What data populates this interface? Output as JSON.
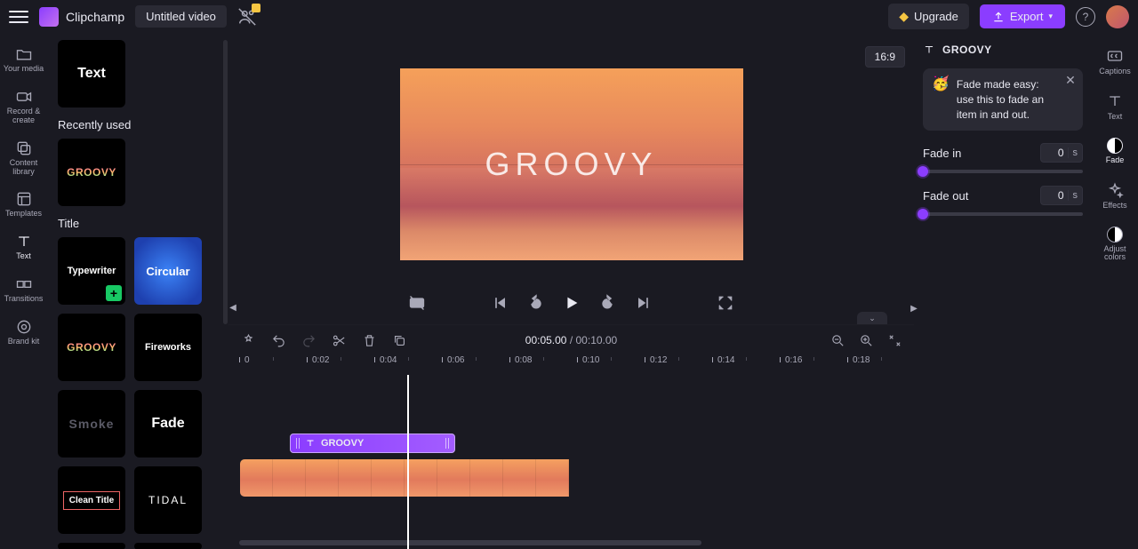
{
  "header": {
    "brand": "Clipchamp",
    "project_title": "Untitled video",
    "upgrade_label": "Upgrade",
    "export_label": "Export",
    "aspect_ratio": "16:9"
  },
  "left_nav": {
    "items": [
      {
        "label": "Your media",
        "icon": "folder"
      },
      {
        "label": "Record & create",
        "icon": "camera"
      },
      {
        "label": "Content library",
        "icon": "layers"
      },
      {
        "label": "Templates",
        "icon": "template"
      },
      {
        "label": "Text",
        "icon": "text",
        "active": true
      },
      {
        "label": "Transitions",
        "icon": "transition"
      },
      {
        "label": "Brand kit",
        "icon": "brand"
      }
    ]
  },
  "library": {
    "plain_text_tile": "Text",
    "recently_used_heading": "Recently used",
    "recently_used": [
      {
        "label": "GROOVY",
        "style": "groovy"
      }
    ],
    "title_heading": "Title",
    "titles": [
      {
        "label": "Typewriter",
        "style": "typewriter",
        "add": true
      },
      {
        "label": "Circular",
        "style": "circular"
      },
      {
        "label": "GROOVY",
        "style": "groovy"
      },
      {
        "label": "Fireworks",
        "style": "fireworks"
      },
      {
        "label": "Smoke",
        "style": "smoke"
      },
      {
        "label": "Fade",
        "style": "fade"
      },
      {
        "label": "Clean Title",
        "style": "clean"
      },
      {
        "label": "TIDAL",
        "style": "tidal"
      }
    ]
  },
  "preview": {
    "overlay_text": "GROOVY"
  },
  "timeline": {
    "current_time": "00:05.00",
    "duration": "00:10.00",
    "ruler_ticks": [
      "0",
      "0:02",
      "0:04",
      "0:06",
      "0:08",
      "0:10",
      "0:12",
      "0:14",
      "0:16",
      "0:18"
    ],
    "text_clip_label": "GROOVY"
  },
  "properties": {
    "header_label": "GROOVY",
    "tip_text": "Fade made easy: use this to fade an item in and out.",
    "fade_in_label": "Fade in",
    "fade_in_value": "0",
    "fade_out_label": "Fade out",
    "fade_out_value": "0",
    "seconds_unit": "s"
  },
  "right_nav": {
    "items": [
      {
        "label": "Captions",
        "icon": "cc"
      },
      {
        "label": "Text",
        "icon": "text"
      },
      {
        "label": "Fade",
        "icon": "fade",
        "active": true
      },
      {
        "label": "Effects",
        "icon": "effects"
      },
      {
        "label": "Adjust colors",
        "icon": "adjust"
      }
    ]
  }
}
